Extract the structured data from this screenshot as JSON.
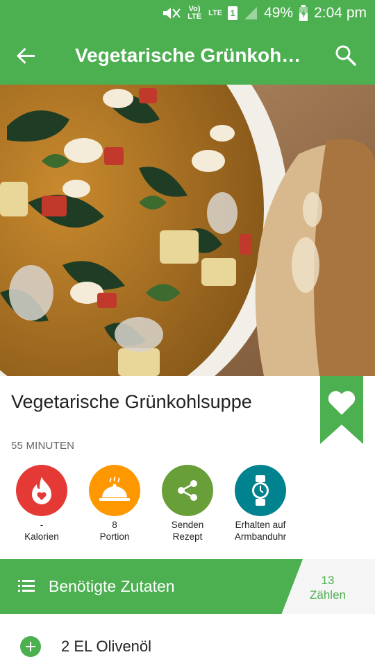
{
  "status_bar": {
    "network_label": "Vo) LTE",
    "lte_label": "LTE",
    "sim_label": "1",
    "battery": "49%",
    "time": "2:04 pm"
  },
  "app_bar": {
    "title": "Vegetarische Grünkohlsuppe",
    "icons": [
      "back-arrow-icon",
      "search-icon"
    ]
  },
  "recipe": {
    "title": "Vegetarische Grünkohlsuppe",
    "duration": "55 MINUTEN"
  },
  "actions": [
    {
      "value": "-",
      "label": "Kalorien",
      "icon": "calories-icon",
      "color": "#e53935"
    },
    {
      "value": "8",
      "label": "Portion",
      "icon": "serving-cloche-icon",
      "color": "#ff9800"
    },
    {
      "value": "Senden",
      "label": "Rezept",
      "icon": "share-icon",
      "color": "#689f38"
    },
    {
      "value": "Erhalten auf",
      "label": "Armbanduhr",
      "icon": "watch-icon",
      "color": "#00838f"
    }
  ],
  "ingredients": {
    "header": "Benötigte Zutaten",
    "count": "13",
    "count_label": "Zählen",
    "items": [
      {
        "text": "2 EL Olivenöl"
      }
    ]
  },
  "colors": {
    "primary": "#4caf50",
    "favorite": "#4caf50"
  }
}
